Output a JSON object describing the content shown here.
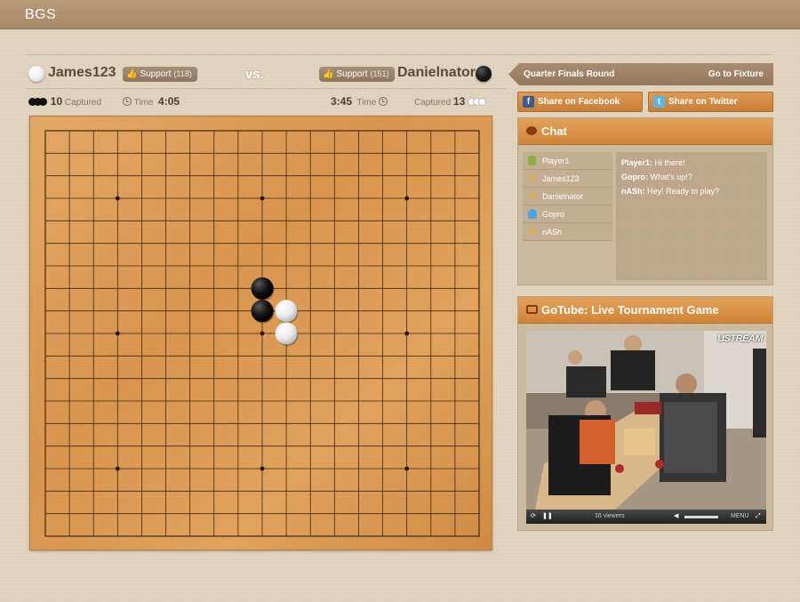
{
  "app": {
    "logo": "BGS"
  },
  "players": {
    "left": {
      "name": "James123",
      "stone": "white",
      "support_label": "Support",
      "support_count": "(118)",
      "captured": "10",
      "captured_label": "Captured",
      "time_label": "Time",
      "time": "4:05"
    },
    "right": {
      "name": "Danielnator",
      "stone": "black",
      "support_label": "Support",
      "support_count": "(151)",
      "captured": "13",
      "captured_label": "Captured",
      "time_label": "Time",
      "time": "3:45"
    },
    "vs_label": "vs."
  },
  "board": {
    "size": 19,
    "star_points": [
      [
        3,
        3
      ],
      [
        9,
        3
      ],
      [
        15,
        3
      ],
      [
        3,
        9
      ],
      [
        9,
        9
      ],
      [
        15,
        9
      ],
      [
        3,
        15
      ],
      [
        9,
        15
      ],
      [
        15,
        15
      ]
    ],
    "stones": [
      {
        "color": "black",
        "col": 9,
        "row": 7
      },
      {
        "color": "black",
        "col": 9,
        "row": 8
      },
      {
        "color": "white",
        "col": 10,
        "row": 8
      },
      {
        "color": "white",
        "col": 10,
        "row": 9
      }
    ]
  },
  "round": {
    "title": "Quarter Finals Round",
    "fixture_link": "Go to Fixture"
  },
  "share": {
    "facebook": "Share on Facebook",
    "twitter": "Share on Twitter"
  },
  "chat": {
    "title": "Chat",
    "users": [
      {
        "name": "Player1",
        "icon": "green-person-icon"
      },
      {
        "name": "James123",
        "icon": "star-icon"
      },
      {
        "name": "Danielnator",
        "icon": "star-icon"
      },
      {
        "name": "Gopro",
        "icon": "blue-person-icon"
      },
      {
        "name": "nASh",
        "icon": "star-icon"
      }
    ],
    "messages": [
      {
        "author": "Player1:",
        "text": "Hi there!"
      },
      {
        "author": "Gopro:",
        "text": "What's up!?"
      },
      {
        "author": "nASh:",
        "text": "Hey! Ready to play?"
      }
    ]
  },
  "video": {
    "title": "GoTube: Live Tournament Game",
    "brand": "USTREAM",
    "viewers": "16 viewers",
    "menu": "MENU"
  },
  "colors": {
    "accent": "#d58a3e",
    "topbar": "#a88a68",
    "board": "#dd9e57"
  }
}
